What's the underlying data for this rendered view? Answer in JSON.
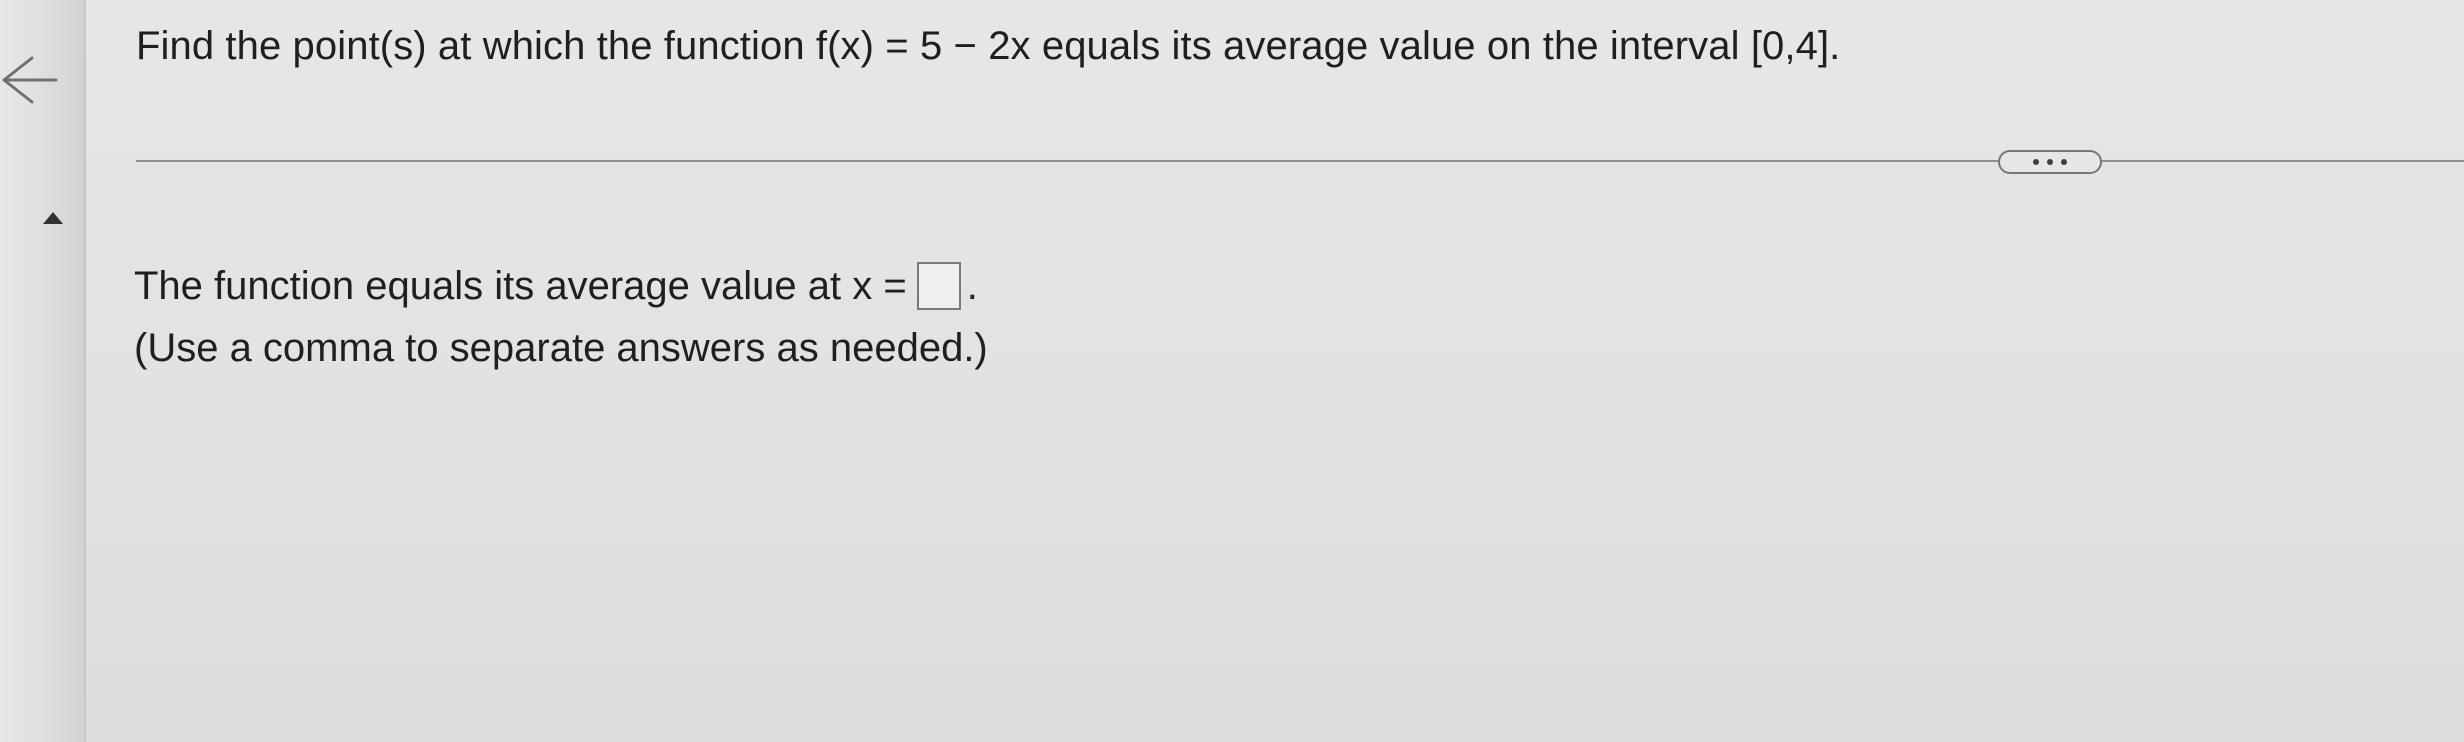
{
  "question": {
    "text": "Find the point(s) at which the function f(x) = 5 − 2x equals its average value on the interval [0,4]."
  },
  "answer": {
    "prompt": "The function equals its average value at x =",
    "input_value": "",
    "suffix": ".",
    "hint": "(Use a comma to separate answers as needed.)"
  },
  "controls": {
    "more_icon": "ellipsis-icon",
    "back_icon": "back-arrow-icon",
    "collapse_icon": "caret-up-icon"
  }
}
